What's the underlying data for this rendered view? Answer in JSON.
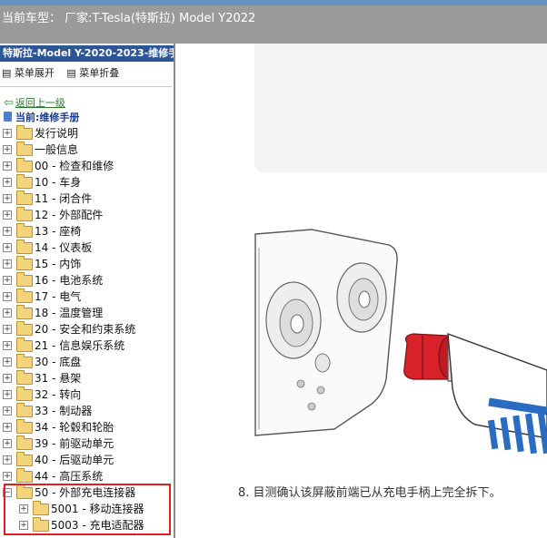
{
  "topbar": {
    "title": "当前车型： 厂家:T-Tesla(特斯拉) Model Y2022"
  },
  "sidebar": {
    "header": "特斯拉-Model Y-2020-2023-维修手",
    "expand_label": "菜单展开",
    "collapse_label": "菜单折叠",
    "back_label": "返回上一级",
    "current_label": "当前:维修手册",
    "items": [
      {
        "label": "发行说明",
        "level": 0
      },
      {
        "label": "一般信息",
        "level": 0
      },
      {
        "label": "00 - 检查和维修",
        "level": 0
      },
      {
        "label": "10 - 车身",
        "level": 0
      },
      {
        "label": "11 - 闭合件",
        "level": 0
      },
      {
        "label": "12 - 外部配件",
        "level": 0
      },
      {
        "label": "13 - 座椅",
        "level": 0
      },
      {
        "label": "14 - 仪表板",
        "level": 0
      },
      {
        "label": "15 - 内饰",
        "level": 0
      },
      {
        "label": "16 - 电池系统",
        "level": 0
      },
      {
        "label": "17 - 电气",
        "level": 0
      },
      {
        "label": "18 - 温度管理",
        "level": 0
      },
      {
        "label": "20 - 安全和约束系统",
        "level": 0
      },
      {
        "label": "21 - 信息娱乐系统",
        "level": 0
      },
      {
        "label": "30 - 底盘",
        "level": 0
      },
      {
        "label": "31 - 悬架",
        "level": 0
      },
      {
        "label": "32 - 转向",
        "level": 0
      },
      {
        "label": "33 - 制动器",
        "level": 0
      },
      {
        "label": "34 - 轮毂和轮胎",
        "level": 0
      },
      {
        "label": "39 - 前驱动单元",
        "level": 0
      },
      {
        "label": "40 - 后驱动单元",
        "level": 0
      },
      {
        "label": "44 - 高压系统",
        "level": 0
      },
      {
        "label": "50 - 外部充电连接器",
        "level": 0,
        "expanded": true
      },
      {
        "label": "5001 - 移动连接器",
        "level": 1
      },
      {
        "label": "5003 - 充电适配器",
        "level": 1
      }
    ]
  },
  "content": {
    "step_text": "8. 目测确认该屏蔽前端已从充电手柄上完全拆下。"
  },
  "colors": {
    "header_blue": "#2b5797",
    "highlight_red": "#e02020"
  }
}
